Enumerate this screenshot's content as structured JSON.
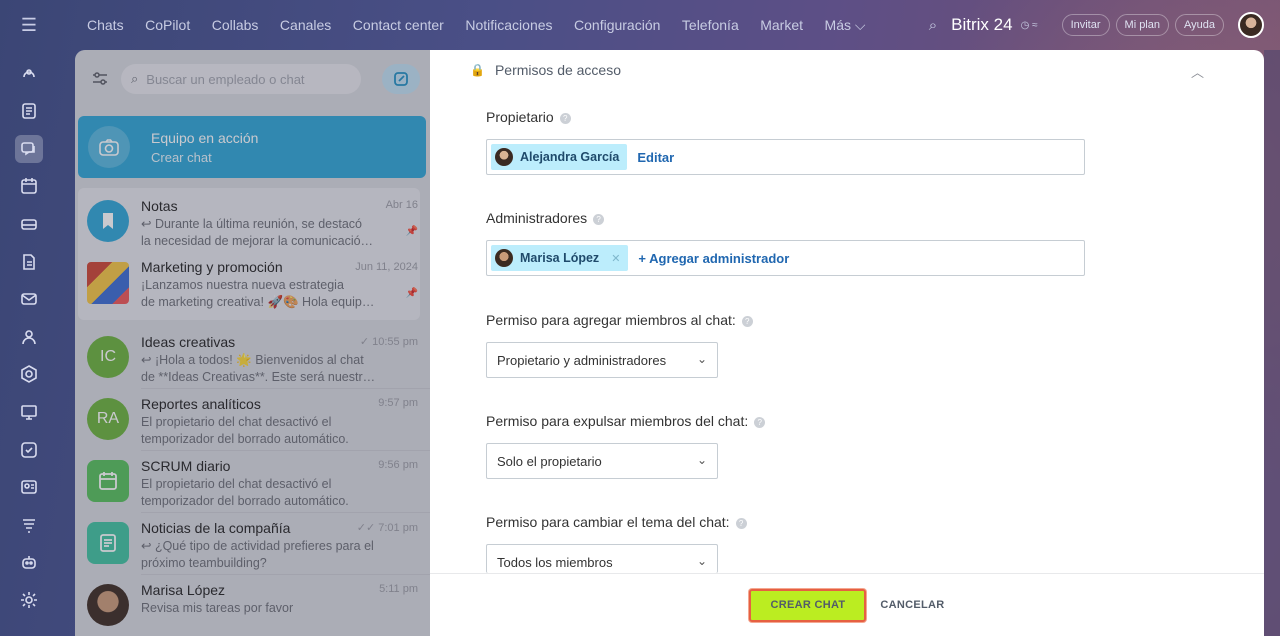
{
  "topnav": {
    "items": [
      "Chats",
      "CoPilot",
      "Collabs",
      "Canales",
      "Contact center",
      "Notificaciones",
      "Configuración",
      "Telefonía",
      "Market",
      "Más ⌵"
    ],
    "brand": "Bitrix 24",
    "invite": "Invitar",
    "myplan": "Mi plan",
    "help": "Ayuda"
  },
  "sidebar": {
    "search_placeholder": "Buscar un empleado o chat",
    "team": {
      "title": "Equipo en acción",
      "subtitle": "Crear chat"
    },
    "chats": [
      {
        "name": "Notas",
        "time": "Abr 16",
        "line1": "↩ Durante la última reunión, se destacó",
        "line2": "la necesidad de mejorar la comunicació…"
      },
      {
        "name": "Marketing y promoción",
        "time": "Jun 11, 2024",
        "line1": "¡Lanzamos nuestra nueva estrategia",
        "line2": "de marketing creativa! 🚀🎨 Hola equipo…"
      },
      {
        "name": "Ideas creativas",
        "time": "✓ 10:55 pm",
        "initials": "IC",
        "line1": "↩ ¡Hola a todos! 🌟 Bienvenidos al chat",
        "line2": "de **Ideas Creativas**. Este será nuestr…"
      },
      {
        "name": "Reportes analíticos",
        "time": "9:57 pm",
        "initials": "RA",
        "line1": "El propietario del chat desactivó el",
        "line2": "temporizador del borrado automático."
      },
      {
        "name": "SCRUM diario",
        "time": "9:56 pm",
        "line1": "El propietario del chat desactivó el",
        "line2": "temporizador del borrado automático."
      },
      {
        "name": "Noticias de la compañía",
        "time": "✓✓ 7:01 pm",
        "line1": "↩ ¿Qué tipo de actividad prefieres para el",
        "line2": "próximo teambuilding?"
      },
      {
        "name": "Marisa López",
        "time": "5:11 pm",
        "line1": "Revisa mis tareas por favor",
        "line2": ""
      }
    ]
  },
  "modal": {
    "section_title": "Permisos de acceso",
    "owner_label": "Propietario",
    "owner_name": "Alejandra García",
    "owner_edit": "Editar",
    "admins_label": "Administradores",
    "admin_name": "Marisa López",
    "add_admin": "+ Agregar administrador",
    "perm_add_label": "Permiso para agregar miembros al chat:",
    "perm_add_value": "Propietario y administradores",
    "perm_kick_label": "Permiso para expulsar miembros del chat:",
    "perm_kick_value": "Solo el propietario",
    "perm_topic_label": "Permiso para cambiar el tema del chat:",
    "perm_topic_value": "Todos los miembros",
    "create_button": "CREAR CHAT",
    "cancel_button": "CANCELAR"
  },
  "colors": {
    "accent": "#2da6d6",
    "create": "#bbed21",
    "highlight": "#e66042"
  }
}
